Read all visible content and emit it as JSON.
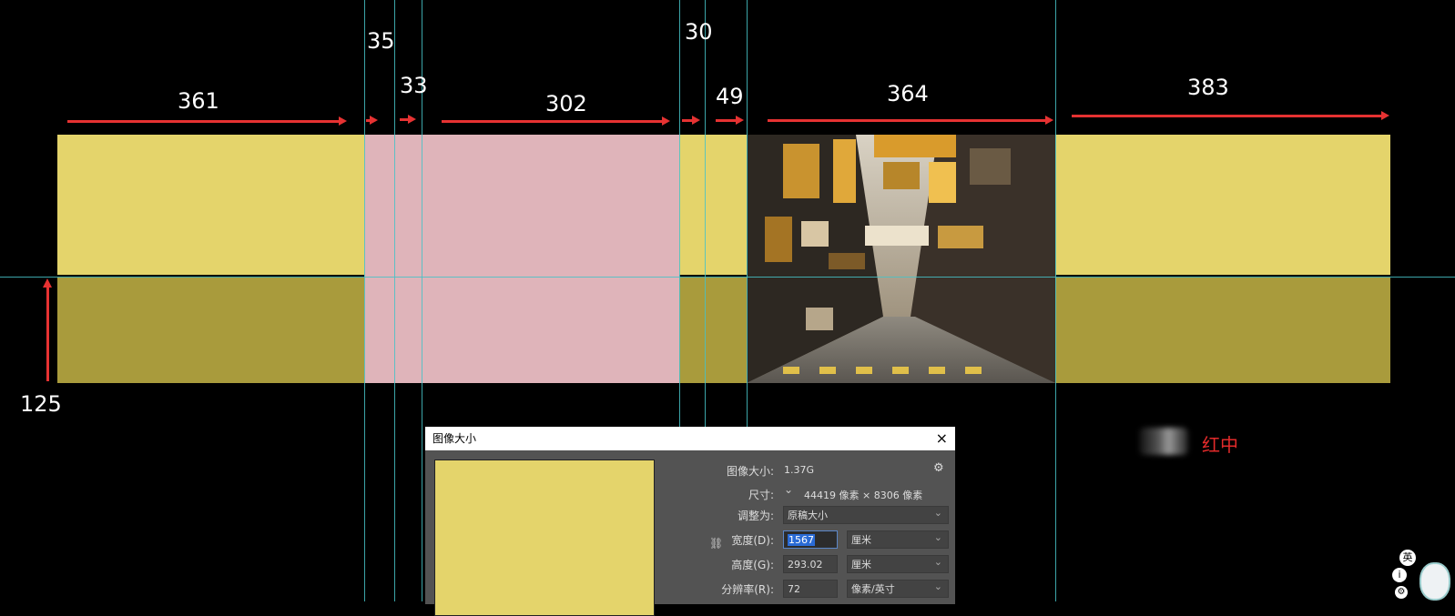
{
  "measurements": {
    "w1": "361",
    "w2": "35",
    "w3": "33",
    "w4": "302",
    "w5": "30",
    "w6": "49",
    "w7": "364",
    "w8": "383",
    "height": "125"
  },
  "colors": {
    "yellow": "#e4d46b",
    "olive": "#a99b3c",
    "pink": "#dfb4ba",
    "guide": "#46c2c7",
    "arrow": "#e63232"
  },
  "dialog": {
    "title": "图像大小",
    "close": "×",
    "image_size_label": "图像大小:",
    "image_size_value": "1.37G",
    "dimensions_label": "尺寸:",
    "dimensions_value": "44419 像素 × 8306 像素",
    "fit_label": "调整为:",
    "fit_value": "原稿大小",
    "width_label": "宽度(D):",
    "width_value": "1567",
    "width_unit": "厘米",
    "height_label": "高度(G):",
    "height_value": "293.02",
    "height_unit": "厘米",
    "resolution_label": "分辨率(R):",
    "resolution_value": "72",
    "resolution_unit": "像素/英寸"
  },
  "watermark": {
    "text": "红中"
  },
  "ime": {
    "label": "英"
  }
}
